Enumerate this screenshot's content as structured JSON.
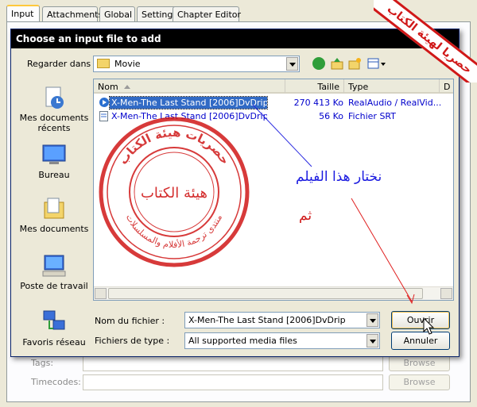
{
  "app": {
    "tabs": [
      {
        "label": "Input"
      },
      {
        "label": "Attachments"
      },
      {
        "label": "Global"
      },
      {
        "label": "Settings"
      },
      {
        "label": "Chapter Editor"
      }
    ],
    "bg_fields": [
      {
        "label": "Tags:",
        "button": "Browse"
      },
      {
        "label": "Timecodes:",
        "button": "Browse"
      }
    ]
  },
  "dialog": {
    "title": "Choose an input file to add",
    "look_in_label": "Regarder dans :",
    "look_in_value": "Movie",
    "toolbar_icons": [
      "back-icon",
      "up-folder-icon",
      "new-folder-icon",
      "view-menu-icon"
    ],
    "places": [
      {
        "label": "Mes documents récents",
        "icon": "recent-documents-icon"
      },
      {
        "label": "Bureau",
        "icon": "desktop-icon"
      },
      {
        "label": "Mes documents",
        "icon": "my-documents-icon"
      },
      {
        "label": "Poste de travail",
        "icon": "my-computer-icon"
      },
      {
        "label": "Favoris réseau",
        "icon": "network-places-icon"
      }
    ],
    "columns": {
      "name": "Nom",
      "size": "Taille",
      "type": "Type",
      "date": "D"
    },
    "files": [
      {
        "name": "X-Men-The Last Stand [2006]DvDrip",
        "size": "270 413 Ko",
        "type": "RealAudio / RealVid...",
        "icon": "realmedia-file-icon",
        "selected": true
      },
      {
        "name": "X-Men-The Last Stand [2006]DvDrip",
        "size": "56 Ko",
        "type": "Fichier SRT",
        "icon": "text-file-icon",
        "selected": false
      }
    ],
    "filename_label": "Nom du fichier :",
    "filename_value": "X-Men-The Last Stand [2006]DvDrip",
    "filetype_label": "Fichiers de type :",
    "filetype_value": "All supported media files",
    "open_button": "Ouvrir",
    "cancel_button": "Annuler"
  },
  "annotations": {
    "choose_file_text": "نختار هذا الفيلم",
    "then_text": "ثم",
    "banner_text": "حصريا لهيئة الكتاب",
    "stamp_center_text": "هيئة الكتاب",
    "stamp_ring_text": "حصريات هيئة الكتاب",
    "stamp_lower_ring_text": "منتدى ترجمة الأفلام والمسلسلات",
    "colors": {
      "annotation_blue": "#1a1ae0",
      "stamp_red": "#d01818",
      "arrow_red": "#e02020"
    }
  }
}
